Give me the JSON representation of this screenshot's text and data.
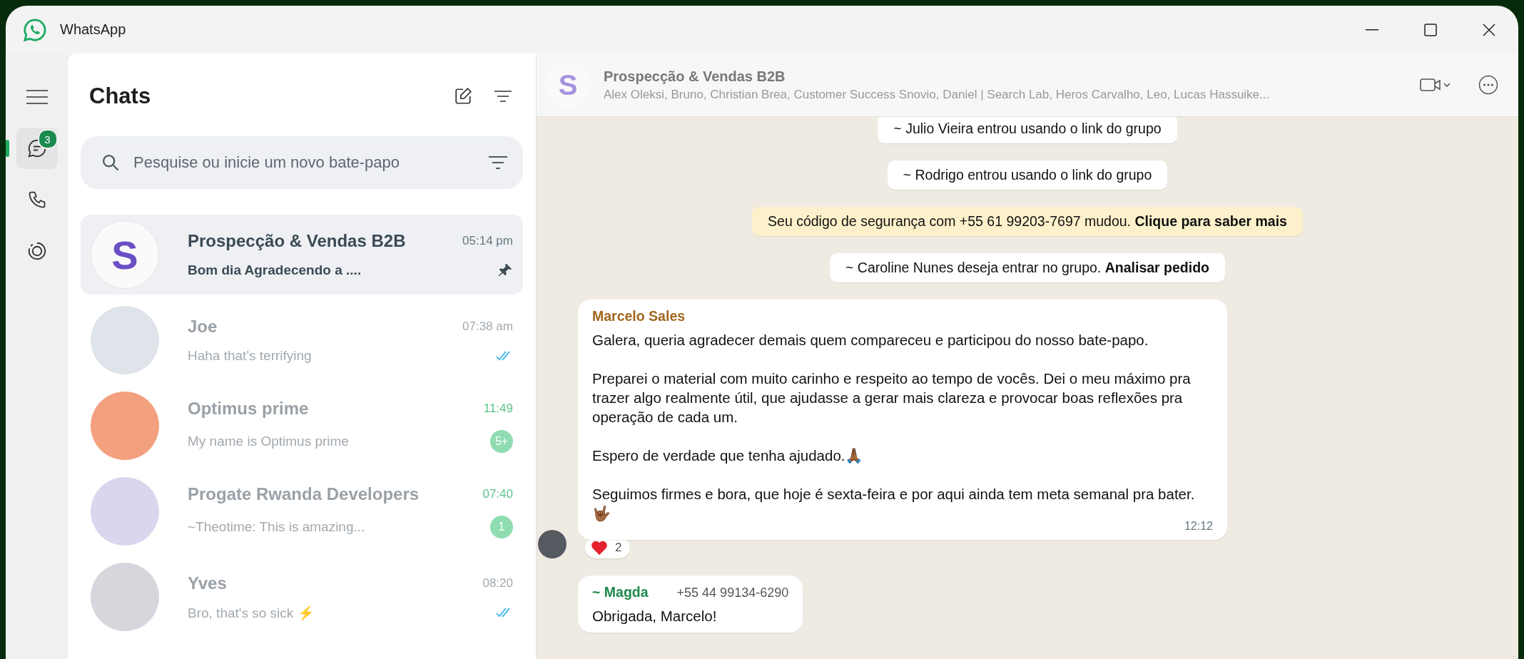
{
  "window": {
    "title": "WhatsApp"
  },
  "rail": {
    "items": [
      {
        "kind": "chats",
        "selected": true,
        "badge": "3"
      },
      {
        "kind": "calls",
        "selected": false
      },
      {
        "kind": "status",
        "selected": false
      }
    ]
  },
  "chat_list": {
    "title": "Chats",
    "search": {
      "placeholder": "Pesquise ou inicie um novo bate-papo"
    },
    "chats": [
      {
        "name": "Prospecção & Vendas B2B",
        "avatar_letter": "S",
        "time": "05:14 pm",
        "preview": "Bom dia Agradecendo a ....",
        "selected": true,
        "pinned": true,
        "color": "#6a4fc4"
      },
      {
        "name": "Joe",
        "time": "07:38 am",
        "preview": "Haha that's terrifying",
        "selected": false,
        "read_ticks": true,
        "color": "#dfe3ea"
      },
      {
        "name": "Optimus prime",
        "time": "11:49",
        "preview": "My name is Optimus prime",
        "selected": false,
        "unread": "5+",
        "color": "#f3a07e"
      },
      {
        "name": "Progate Rwanda Developers",
        "time": "07:40",
        "preview": "~Theotime: This is amazing...",
        "selected": false,
        "unread": "1",
        "color": "#d9d6ee"
      },
      {
        "name": "Yves",
        "time": "08:20",
        "preview": "Bro, that's so sick ⚡",
        "selected": false,
        "read_ticks": true,
        "color": "#d5d7dc"
      }
    ]
  },
  "conversation": {
    "avatar_letter": "S",
    "title": "Prospecção & Vendas B2B",
    "members": "Alex Oleksi, Bruno, Christian Brea, Customer Success Snovio, Daniel | Search Lab, Heros Carvalho, Leo, Lucas Hassuike...",
    "system_messages": [
      {
        "kind": "info",
        "text": "~ Julio Vieira entrou usando o link do grupo"
      },
      {
        "kind": "info",
        "text": "~ Rodrigo entrou usando o link do grupo"
      },
      {
        "kind": "security",
        "text": "Seu código de segurança com +55 61 99203-7697 mudou.",
        "link": "Clique para saber mais"
      },
      {
        "kind": "info",
        "text": "~ Caroline Nunes deseja entrar no grupo.",
        "link": "Analisar pedido"
      }
    ],
    "messages": [
      {
        "sender": "Marcelo Sales",
        "color": "#a0661d",
        "paragraphs": [
          "Galera, queria agradecer demais quem compareceu e participou do nosso bate-papo.",
          "Preparei o material com muito carinho e respeito ao tempo de vocês. Dei o meu máximo pra trazer algo realmente útil, que ajudasse a gerar mais clareza e provocar boas reflexões pra operação de cada um.",
          "Espero de verdade que tenha ajudado.🙏🏾",
          "Seguimos firmes e bora, que hoje é sexta-feira e por aqui ainda tem meta semanal pra bater. 🤟🏾"
        ],
        "time": "12:12",
        "reaction_count": "2"
      },
      {
        "sender": "~ Magda",
        "color": "#1f8a4c",
        "paragraphs": [
          "Obrigada, Marcelo!"
        ],
        "phone": "+55 44 99134-6290"
      }
    ]
  }
}
